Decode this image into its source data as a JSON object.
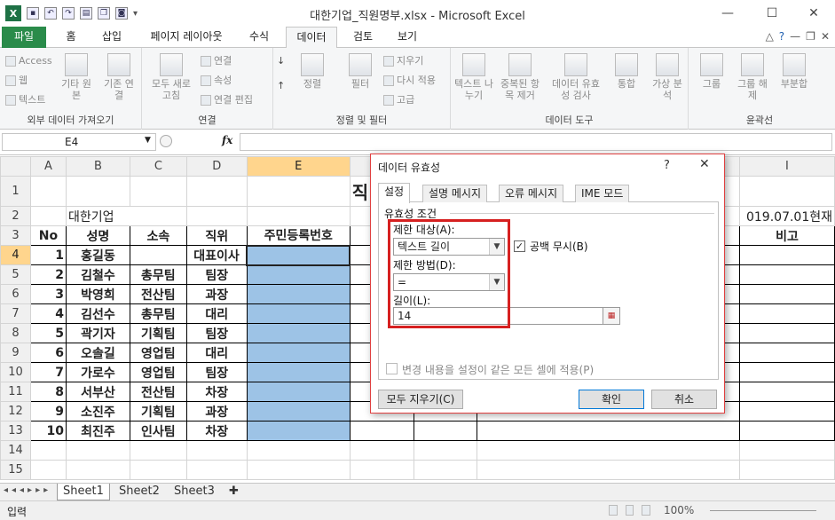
{
  "window": {
    "title": "대한기업_직원명부.xlsx - Microsoft Excel",
    "controls": [
      "—",
      "☐",
      "✕"
    ]
  },
  "ribbon": {
    "tabs": [
      "파일",
      "홈",
      "삽입",
      "페이지 레이아웃",
      "수식",
      "데이터",
      "검토",
      "보기"
    ],
    "active_tab": "데이터",
    "groups": [
      {
        "label": "외부 데이터 가져오기",
        "items": [
          "Access",
          "웹",
          "텍스트",
          "기타 원본",
          "기존 연결"
        ]
      },
      {
        "label": "연결",
        "items": [
          "모두 새로 고침",
          "연결",
          "속성",
          "연결 편집"
        ]
      },
      {
        "label": "정렬 및 필터",
        "items": [
          "정렬",
          "필터",
          "지우기",
          "다시 적용",
          "고급"
        ]
      },
      {
        "label": "데이터 도구",
        "items": [
          "텍스트 나누기",
          "중복된 항목 제거",
          "데이터 유효성 검사",
          "통합",
          "가상 분석"
        ]
      },
      {
        "label": "윤곽선",
        "items": [
          "그룹",
          "그룹 해제",
          "부분합"
        ]
      }
    ]
  },
  "formula_bar": {
    "name_box": "E4",
    "fx": "fx",
    "formula": ""
  },
  "sheet": {
    "col_headers": [
      "A",
      "B",
      "C",
      "D",
      "E",
      "F",
      "G",
      "H",
      "I"
    ],
    "selected_col": "E",
    "row_headers": [
      "1",
      "2",
      "3",
      "4",
      "5",
      "6",
      "7",
      "8",
      "9",
      "10",
      "11",
      "12",
      "13",
      "14",
      "15"
    ],
    "title_fragment": "직",
    "company": "대한기업",
    "date_note": "019.07.01현재",
    "headers": [
      "No",
      "성명",
      "소속",
      "직위",
      "주민등록번호",
      "입",
      "",
      "",
      "비고"
    ],
    "rows": [
      [
        "1",
        "홍길동",
        "",
        "대표이사"
      ],
      [
        "2",
        "김철수",
        "총무팀",
        "팀장"
      ],
      [
        "3",
        "박영희",
        "전산팀",
        "과장"
      ],
      [
        "4",
        "김선수",
        "총무팀",
        "대리"
      ],
      [
        "5",
        "곽기자",
        "기획팀",
        "팀장"
      ],
      [
        "6",
        "오솔길",
        "영업팀",
        "대리"
      ],
      [
        "7",
        "가로수",
        "영업팀",
        "팀장"
      ],
      [
        "8",
        "서부산",
        "전산팀",
        "차장"
      ],
      [
        "9",
        "소진주",
        "기획팀",
        "과장"
      ],
      [
        "10",
        "최진주",
        "인사팀",
        "차장"
      ]
    ]
  },
  "sheet_tabs": [
    "Sheet1",
    "Sheet2",
    "Sheet3"
  ],
  "status": {
    "mode": "입력",
    "zoom": "100%"
  },
  "dialog": {
    "title": "데이터 유효성",
    "help": "?",
    "close": "✕",
    "tabs": [
      "설정",
      "설명 메시지",
      "오류 메시지",
      "IME 모드"
    ],
    "active_tab": "설정",
    "section": "유효성 조건",
    "allow_label": "제한 대상(A):",
    "allow_value": "텍스트 길이",
    "ignore_blank": "공백 무시(B)",
    "data_label": "제한 방법(D):",
    "data_value": "=",
    "length_label": "길이(L):",
    "length_value": "14",
    "apply_all": "변경 내용을 설정이 같은 모든 셀에 적용(P)",
    "clear_all": "모두 지우기(C)",
    "ok": "확인",
    "cancel": "취소"
  }
}
